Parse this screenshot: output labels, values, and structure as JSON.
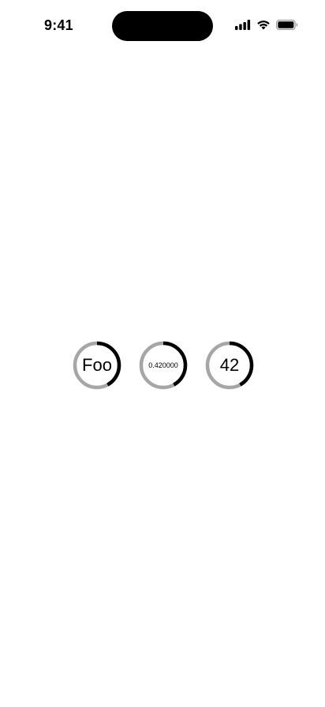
{
  "status_bar": {
    "time": "9:41",
    "icons": [
      "signal-icon",
      "wifi-icon",
      "battery-icon"
    ]
  },
  "gauges": [
    {
      "label": "Foo",
      "progress": 0.42
    },
    {
      "label": "0.420000",
      "progress": 0.42
    },
    {
      "label": "42",
      "progress": 0.42
    }
  ],
  "colors": {
    "track": "#a6a6a6",
    "progress": "#000000",
    "background": "#ffffff"
  }
}
